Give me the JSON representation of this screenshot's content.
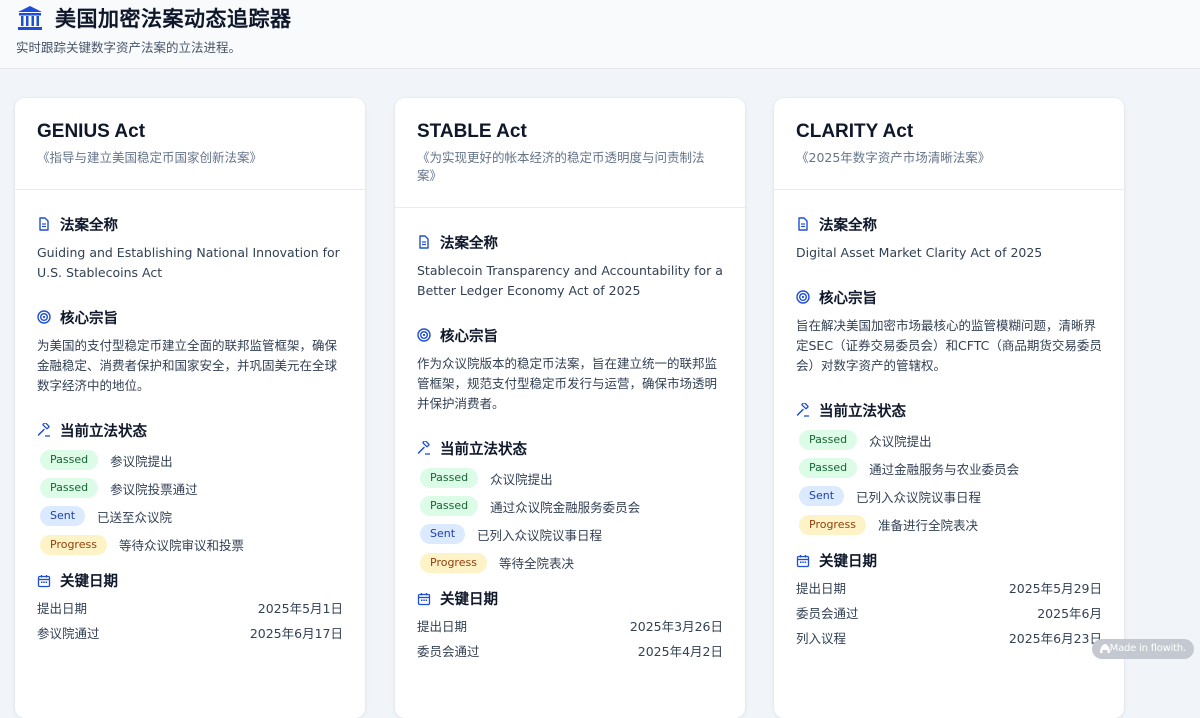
{
  "header": {
    "title": "美国加密法案动态追踪器",
    "subtitle": "实时跟踪关键数字资产法案的立法进程。"
  },
  "section_labels": {
    "full_name": "法案全称",
    "purpose": "核心宗旨",
    "status": "当前立法状态",
    "dates": "关键日期"
  },
  "badge_labels": {
    "passed": "Passed",
    "sent": "Sent",
    "progress": "Progress"
  },
  "cards": [
    {
      "name": "GENIUS Act",
      "cn_name": "《指导与建立美国稳定币国家创新法案》",
      "full_name": "Guiding and Establishing National Innovation for U.S. Stablecoins Act",
      "purpose": "为美国的支付型稳定币建立全面的联邦监管框架，确保金融稳定、消费者保护和国家安全，并巩固美元在全球数字经济中的地位。",
      "status": [
        {
          "badge": "Passed",
          "text": "参议院提出"
        },
        {
          "badge": "Passed",
          "text": "参议院投票通过"
        },
        {
          "badge": "Sent",
          "text": "已送至众议院"
        },
        {
          "badge": "Progress",
          "text": "等待众议院审议和投票"
        }
      ],
      "dates": [
        {
          "label": "提出日期",
          "value": "2025年5月1日"
        },
        {
          "label": "参议院通过",
          "value": "2025年6月17日"
        }
      ]
    },
    {
      "name": "STABLE Act",
      "cn_name": "《为实现更好的帐本经济的稳定币透明度与问责制法案》",
      "full_name": "Stablecoin Transparency and Accountability for a Better Ledger Economy Act of 2025",
      "purpose": "作为众议院版本的稳定币法案，旨在建立统一的联邦监管框架，规范支付型稳定币发行与运营，确保市场透明并保护消费者。",
      "status": [
        {
          "badge": "Passed",
          "text": "众议院提出"
        },
        {
          "badge": "Passed",
          "text": "通过众议院金融服务委员会"
        },
        {
          "badge": "Sent",
          "text": "已列入众议院议事日程"
        },
        {
          "badge": "Progress",
          "text": "等待全院表决"
        }
      ],
      "dates": [
        {
          "label": "提出日期",
          "value": "2025年3月26日"
        },
        {
          "label": "委员会通过",
          "value": "2025年4月2日"
        }
      ]
    },
    {
      "name": "CLARITY Act",
      "cn_name": "《2025年数字资产市场清晰法案》",
      "full_name": "Digital Asset Market Clarity Act of 2025",
      "purpose": "旨在解决美国加密市场最核心的监管模糊问题，清晰界定SEC（证券交易委员会）和CFTC（商品期货交易委员会）对数字资产的管辖权。",
      "status": [
        {
          "badge": "Passed",
          "text": "众议院提出"
        },
        {
          "badge": "Passed",
          "text": "通过金融服务与农业委员会"
        },
        {
          "badge": "Sent",
          "text": "已列入众议院议事日程"
        },
        {
          "badge": "Progress",
          "text": "准备进行全院表决"
        }
      ],
      "dates": [
        {
          "label": "提出日期",
          "value": "2025年5月29日"
        },
        {
          "label": "委员会通过",
          "value": "2025年6月"
        },
        {
          "label": "列入议程",
          "value": "2025年6月23日"
        }
      ]
    }
  ],
  "watermark": "Made in flowith.",
  "colors": {
    "accent": "#1d4ed8",
    "passed_bg": "#dcfce7",
    "sent_bg": "#dbeafe",
    "progress_bg": "#fef3c7"
  },
  "icons": {
    "logo": "bank-building-icon",
    "full_name": "document-icon",
    "purpose": "target-icon",
    "status": "gavel-icon",
    "dates": "calendar-icon"
  }
}
